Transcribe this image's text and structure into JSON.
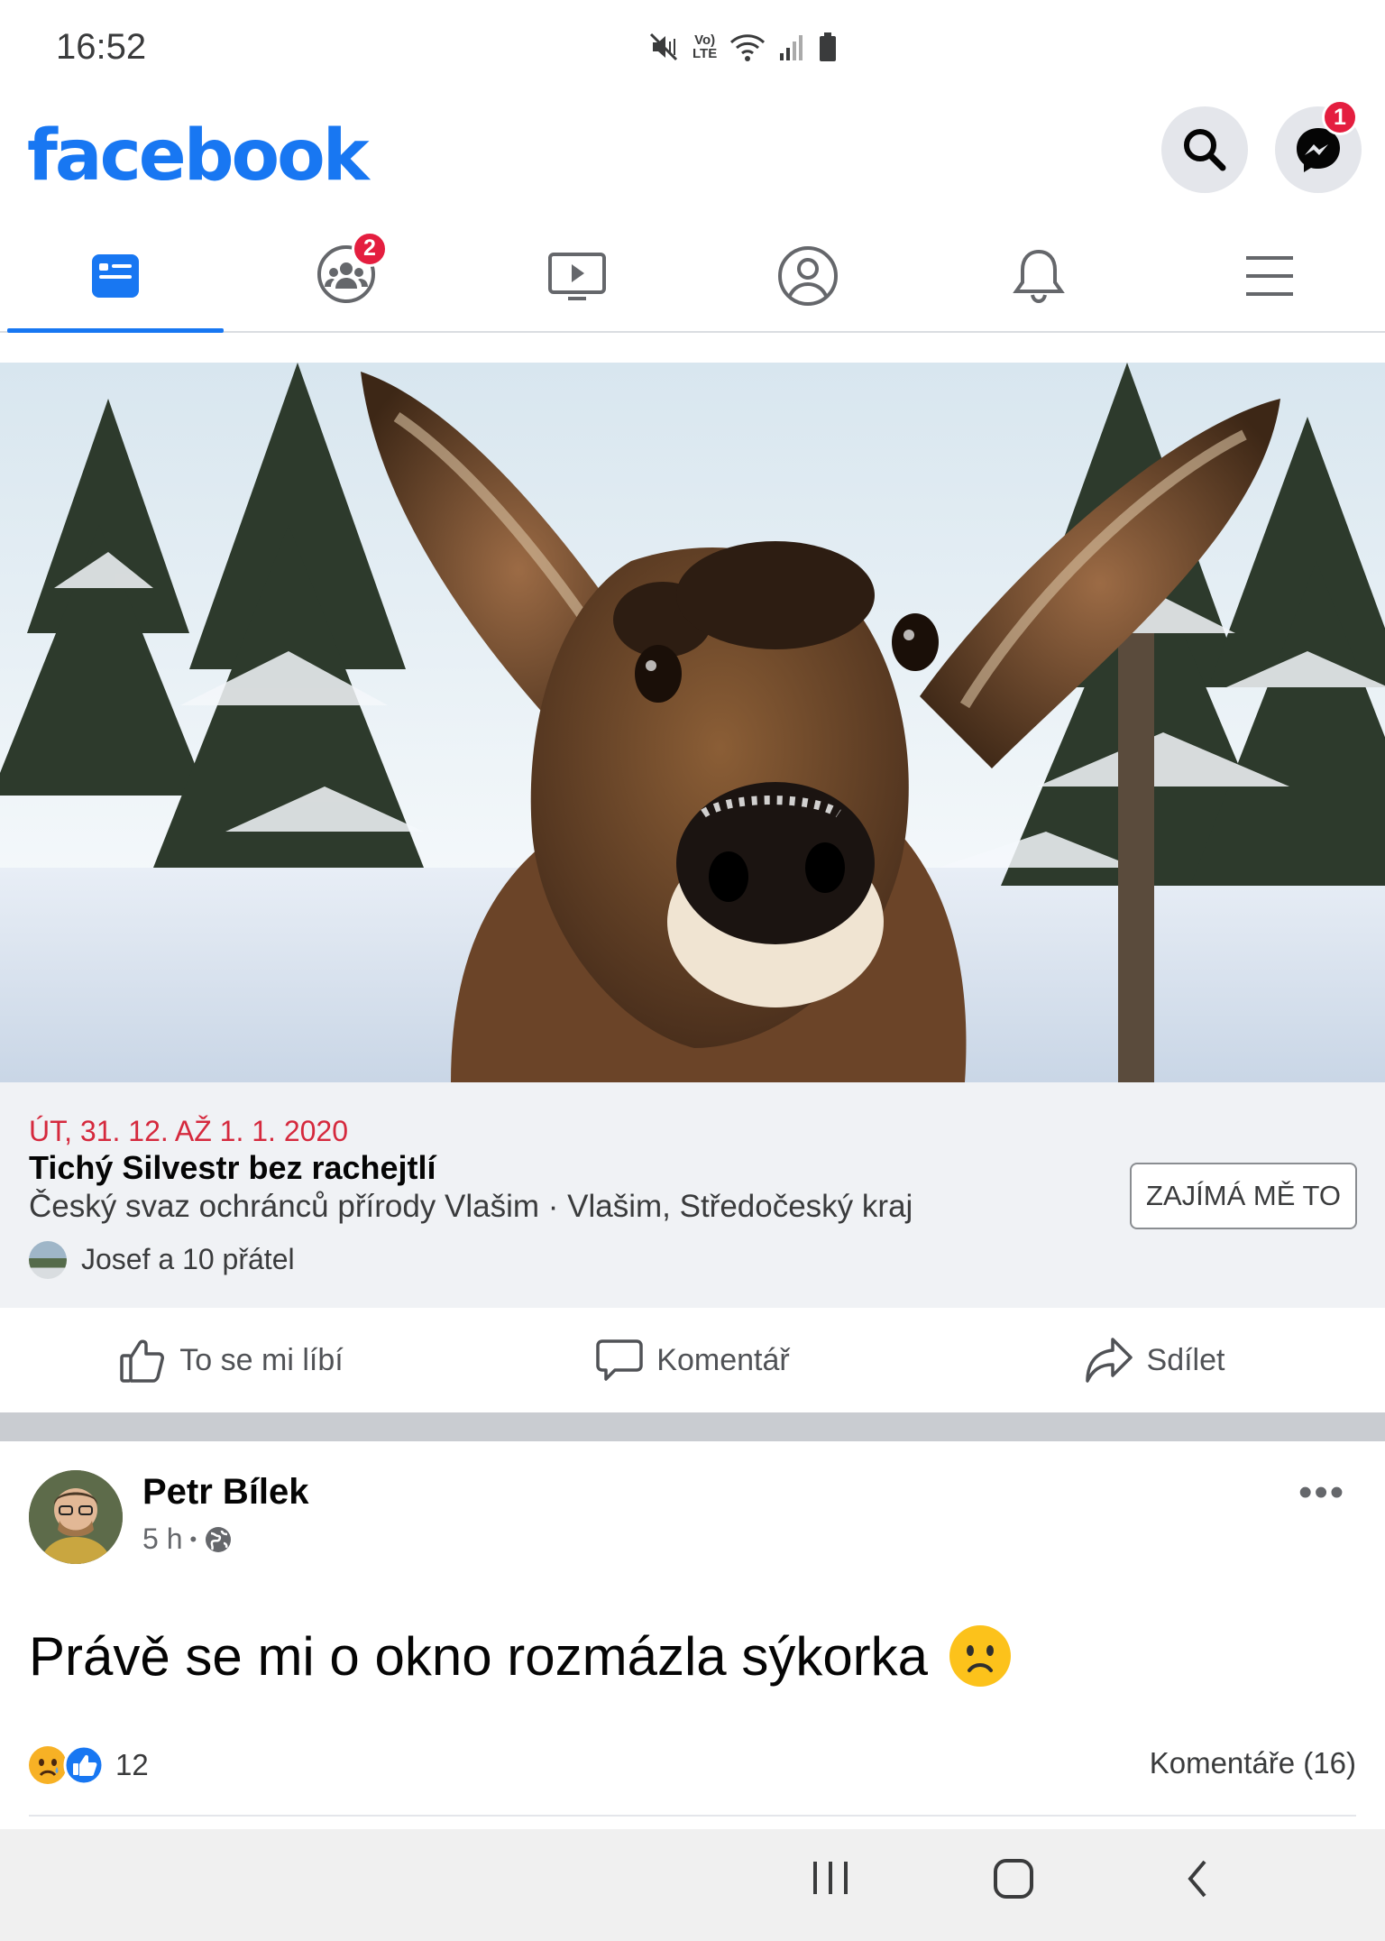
{
  "status_bar": {
    "time": "16:52",
    "volte_label_top": "Vo)",
    "volte_label_bottom": "LTE"
  },
  "header": {
    "logo_text": "facebook",
    "messenger_badge": "1"
  },
  "tabs": [
    {
      "icon": "news-feed-icon",
      "active": true
    },
    {
      "icon": "groups-icon",
      "badge": "2"
    },
    {
      "icon": "watch-icon"
    },
    {
      "icon": "profile-icon"
    },
    {
      "icon": "bell-icon"
    },
    {
      "icon": "menu-icon"
    }
  ],
  "event": {
    "date": "ÚT, 31. 12. AŽ 1. 1. 2020",
    "title": "Tichý Silvestr bez rachejtlí",
    "organizer_location": "Český svaz ochránců přírody Vlašim · Vlašim, Středočeský kraj",
    "interested_label": "ZAJÍMÁ MĚ TO",
    "friends_text": "Josef a 10 přátel"
  },
  "actions": {
    "like": "To se mi líbí",
    "comment": "Komentář",
    "share": "Sdílet"
  },
  "post": {
    "author": "Petr Bílek",
    "time": "5 h",
    "separator": "•",
    "text": "Právě se mi o okno rozmázla sýkorka",
    "reaction_count": "12",
    "comments": "Komentáře (16)"
  },
  "colors": {
    "brand": "#1877f2",
    "badge": "#e41e3f",
    "event_date": "#d5293d"
  }
}
